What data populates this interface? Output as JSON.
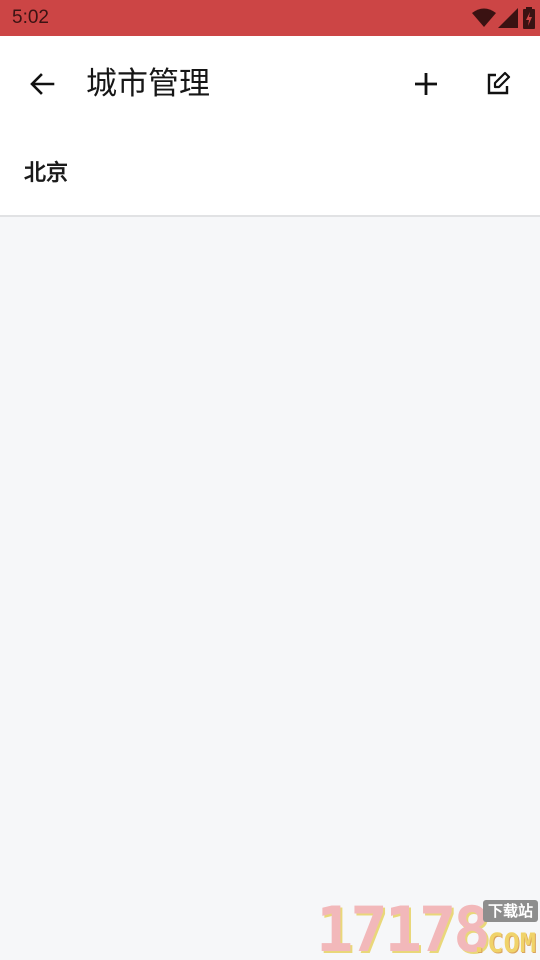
{
  "status_bar": {
    "time": "5:02",
    "icons": [
      "wifi-icon",
      "cellular-signal-icon",
      "battery-charging-icon"
    ],
    "background": "#cc4545"
  },
  "app_bar": {
    "title": "城市管理",
    "actions": [
      "back-arrow-icon",
      "add-icon",
      "edit-icon"
    ]
  },
  "city_list": {
    "items": [
      {
        "label": "北京"
      }
    ]
  },
  "watermark": {
    "digits": "17178",
    "tag": "下载站",
    "suffix": ".COM"
  }
}
